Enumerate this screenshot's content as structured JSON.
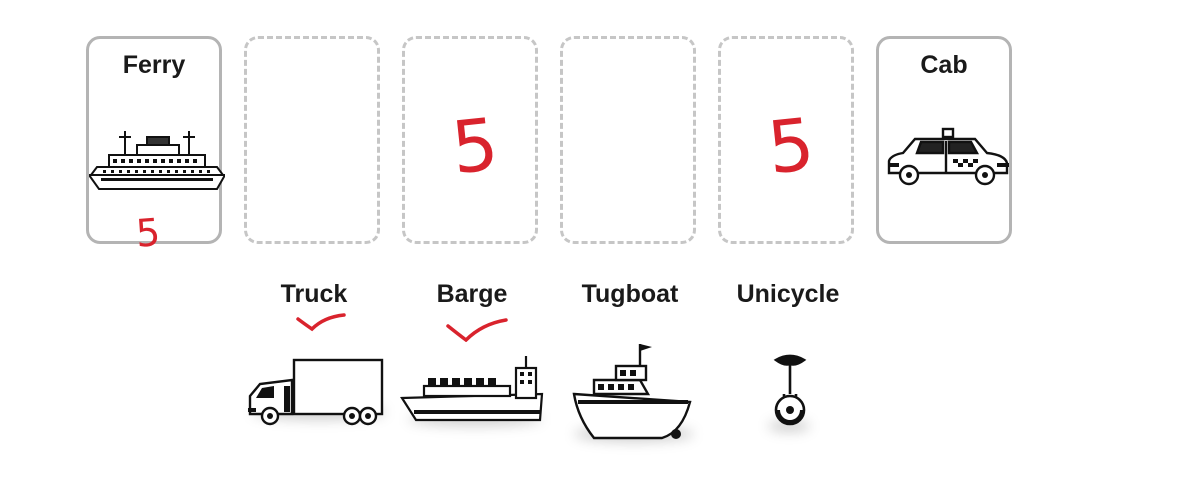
{
  "slots": [
    {
      "state": "filled",
      "label": "Ferry",
      "icon": "ferry-icon",
      "mark": "5"
    },
    {
      "state": "empty"
    },
    {
      "state": "empty",
      "mark": "5"
    },
    {
      "state": "empty"
    },
    {
      "state": "empty",
      "mark": "5"
    },
    {
      "state": "filled",
      "label": "Cab",
      "icon": "taxi-icon"
    }
  ],
  "options": [
    {
      "label": "Truck",
      "icon": "truck-icon",
      "checked": true
    },
    {
      "label": "Barge",
      "icon": "barge-icon",
      "checked": true
    },
    {
      "label": "Tugboat",
      "icon": "tugboat-icon",
      "checked": false
    },
    {
      "label": "Unicycle",
      "icon": "unicycle-icon",
      "checked": false
    }
  ],
  "colors": {
    "annotation": "#d9232d",
    "card_border": "#b4b4b4",
    "dashed_border": "#c6c6c6"
  }
}
